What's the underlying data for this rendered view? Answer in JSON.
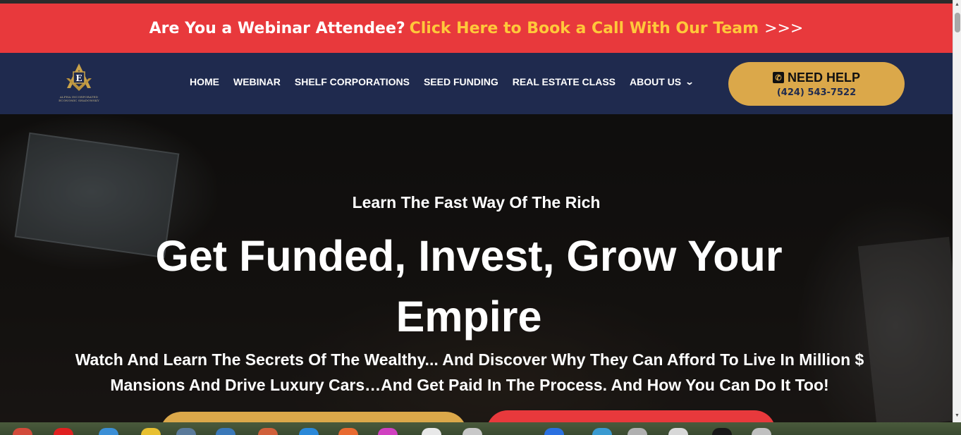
{
  "banner": {
    "question": "Are You a Webinar Attendee?",
    "link_text": "Click Here to Book a Call With Our Team",
    "arrows": ">>>"
  },
  "logo": {
    "letter": "E",
    "caption_line1": "ALPHA INCORPORATED",
    "caption_line2": "ECONOMIC SHADOWSKY"
  },
  "nav": {
    "items": [
      {
        "label": "HOME"
      },
      {
        "label": "WEBINAR"
      },
      {
        "label": "SHELF CORPORATIONS"
      },
      {
        "label": "SEED FUNDING"
      },
      {
        "label": "REAL ESTATE CLASS"
      },
      {
        "label": "ABOUT US"
      }
    ],
    "help_label": "NEED HELP",
    "help_phone": "(424) 543-7522"
  },
  "hero": {
    "eyebrow": "Learn The Fast Way Of The Rich",
    "headline": "Get Funded, Invest, Grow Your Empire",
    "subheadline": "Watch And Learn The Secrets Of The Wealthy... And Discover Why They Can Afford To Live In Million $ Mansions And Drive Luxury Cars…And Get Paid In The Process. And How You Can Do It Too!"
  },
  "colors": {
    "banner_red": "#e8393c",
    "banner_link_yellow": "#ffc83a",
    "nav_navy": "#1f2a4e",
    "gold": "#dba84a"
  },
  "icons": {
    "phone": "phone-icon",
    "about_dropdown": "chevron-down-icon",
    "logo": "masonic-compass-icon"
  }
}
